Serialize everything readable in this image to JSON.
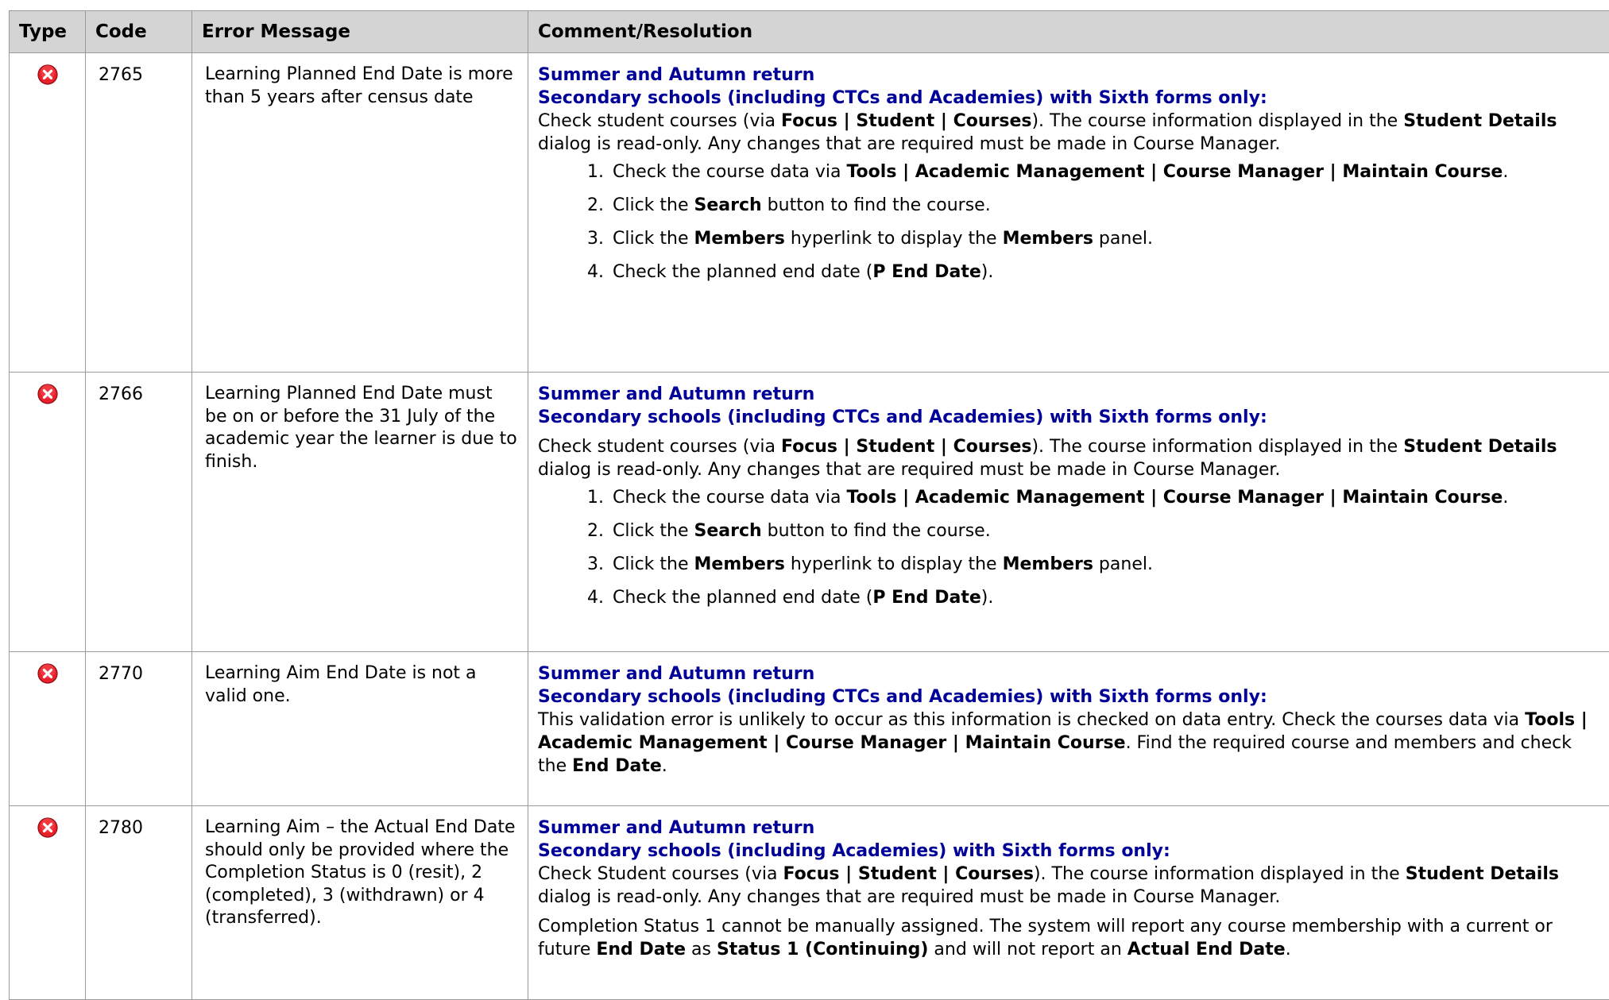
{
  "headers": {
    "type": "Type",
    "code": "Code",
    "message": "Error Message",
    "comment": "Comment/Resolution"
  },
  "rows": [
    {
      "code": "2765",
      "message": "Learning Planned End Date is more than 5 years after census date",
      "head1": "Summer and Autumn return",
      "head2": "Secondary schools (including CTCs and Academies) with Sixth forms only:"
    },
    {
      "code": "2766",
      "message": "Learning Planned End Date must be on or before the 31 July of the academic year the learner is due to finish.",
      "head1": "Summer and Autumn return",
      "head2": "Secondary schools (including CTCs and Academies) with Sixth forms only:"
    },
    {
      "code": "2770",
      "message": "Learning Aim End Date is not a valid one.",
      "head1": "Summer and Autumn return",
      "head2": "Secondary schools (including CTCs and Academies) with Sixth forms only:"
    },
    {
      "code": "2780",
      "message": "Learning Aim – the Actual End Date should only be provided where the Completion Status is 0 (resit), 2 (completed), 3 (withdrawn) or 4 (transferred).",
      "head1": "Summer and Autumn return",
      "head2": "Secondary schools (including Academies) with Sixth forms only:"
    }
  ],
  "text": {
    "check_student_courses": "Check student courses (via ",
    "check_student_courses_cap": "Check Student courses (via ",
    "focus_path": "Focus | Student | Courses",
    "course_info_mid": "). The course information displayed in the ",
    "student_details": "Student Details",
    "read_only_tail": " dialog is read-only. Any changes that are required must be made in Course Manager.",
    "steps": {
      "n1": "1.",
      "n2": "2.",
      "n3": "3.",
      "n4": "4.",
      "s1_pre": "Check the course data via ",
      "s1_path": "Tools | Academic Management | Course Manager | Maintain Course",
      "s1_post": ".",
      "s2_pre": "Click the ",
      "s2_bold": "Search",
      "s2_post": " button to find the course.",
      "s3_pre": "Click the ",
      "s3_bold1": "Members",
      "s3_mid": " hyperlink to display the ",
      "s3_bold2": "Members",
      "s3_post": " panel.",
      "s4_pre": "Check the planned end date (",
      "s4_bold": "P End Date",
      "s4_post": ")."
    },
    "r3_pre": "This validation error is unlikely to occur as this information is checked on data entry. Check the courses data via ",
    "r3_path": "Tools | Academic Management | Course Manager | Maintain Course",
    "r3_mid": ". Find the required course and members and check the ",
    "r3_bold": "End Date",
    "r3_post": ".",
    "r4_p2_pre": "Completion Status 1 cannot be manually assigned. The system will report any course membership with a current or future ",
    "r4_p2_b1": "End Date",
    "r4_p2_mid1": " as ",
    "r4_p2_b2": "Status 1 (Continuing)",
    "r4_p2_mid2": " and will not report an ",
    "r4_p2_b3": "Actual End Date",
    "r4_p2_post": "."
  },
  "icons": {
    "error": "error-icon",
    "error_color": "#e8202a"
  }
}
